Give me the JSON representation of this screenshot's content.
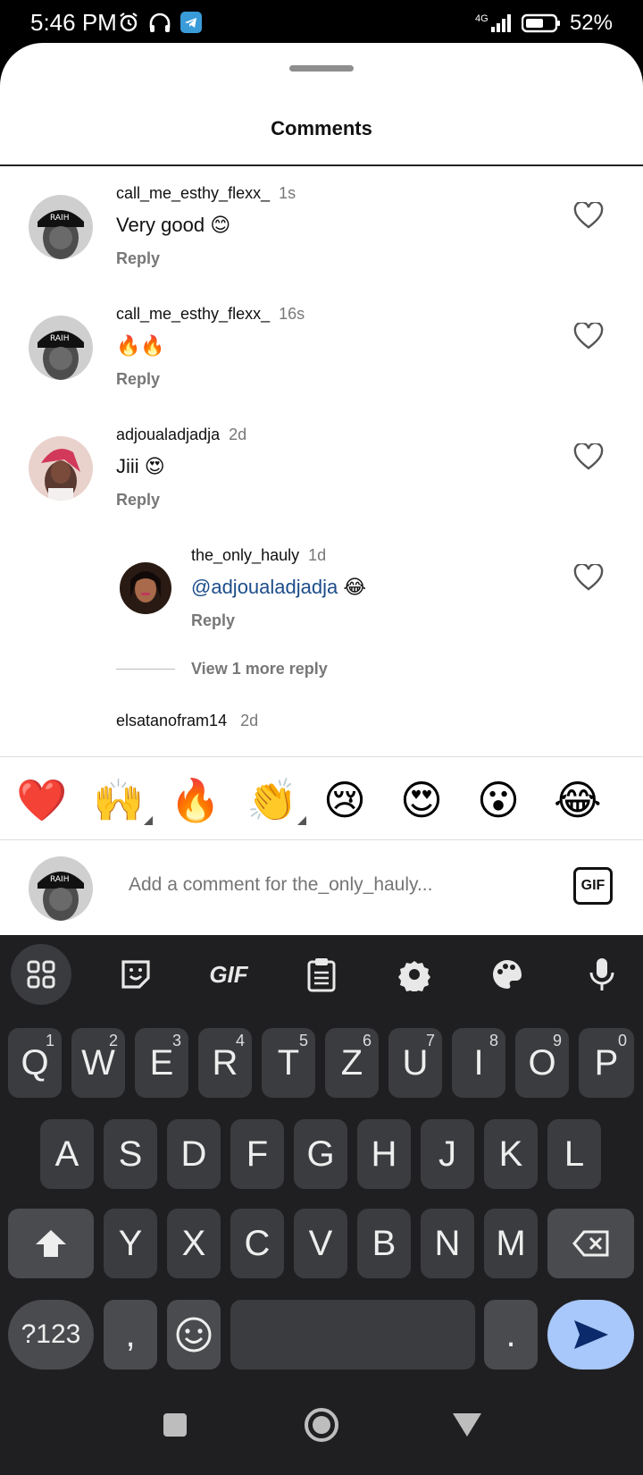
{
  "status": {
    "time": "5:46 PM",
    "network": "4G",
    "battery": "52%"
  },
  "sheet": {
    "title": "Comments"
  },
  "comments": [
    {
      "user": "call_me_esthy_flexx_",
      "time": "1s",
      "text": "Very good 😊",
      "reply": "Reply"
    },
    {
      "user": "call_me_esthy_flexx_",
      "time": "16s",
      "text": "🔥🔥",
      "reply": "Reply"
    },
    {
      "user": "adjoualadjadja",
      "time": "2d",
      "text": "Jiii 😍",
      "reply": "Reply"
    },
    {
      "user": "the_only_hauly",
      "time": "1d",
      "mention": "@adjoualadjadja",
      "text": " 😂",
      "reply": "Reply"
    }
  ],
  "view_more": "View 1 more reply",
  "peek_comment": {
    "user": "elsatanofram14",
    "time": "2d"
  },
  "quick_emojis": [
    "❤️",
    "🙌",
    "🔥",
    "👏",
    "😢",
    "😍",
    "😮",
    "😂"
  ],
  "compose": {
    "placeholder": "Add a comment for the_only_hauly...",
    "gif_label": "GIF"
  },
  "keyboard": {
    "gif_tool": "GIF",
    "row1": [
      [
        "Q",
        "1"
      ],
      [
        "W",
        "2"
      ],
      [
        "E",
        "3"
      ],
      [
        "R",
        "4"
      ],
      [
        "T",
        "5"
      ],
      [
        "Z",
        "6"
      ],
      [
        "U",
        "7"
      ],
      [
        "I",
        "8"
      ],
      [
        "O",
        "9"
      ],
      [
        "P",
        "0"
      ]
    ],
    "row2": [
      "A",
      "S",
      "D",
      "F",
      "G",
      "H",
      "J",
      "K",
      "L"
    ],
    "row3": [
      "Y",
      "X",
      "C",
      "V",
      "B",
      "N",
      "M"
    ],
    "symbols": "?123",
    "comma": ",",
    "period": "."
  }
}
